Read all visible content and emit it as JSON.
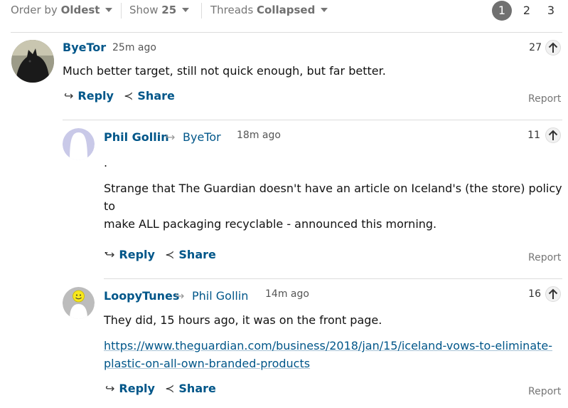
{
  "controls": {
    "order_label": "Order by",
    "order_value": "Oldest",
    "show_label": "Show",
    "show_value": "25",
    "threads_label": "Threads",
    "threads_value": "Collapsed",
    "pages": [
      "1",
      "2",
      "3"
    ],
    "active_page": "1"
  },
  "comments": [
    {
      "author": "ByeTor",
      "time": "25m ago",
      "votes": "27",
      "paragraphs": [
        "Much better target, still not quick enough, but far better."
      ],
      "reply_label": "Reply",
      "share_label": "Share",
      "report_label": "Report"
    },
    {
      "author": "Phil Gollin",
      "in_reply_to": "ByeTor",
      "time": "18m ago",
      "votes": "11",
      "paragraphs": [
        ".",
        "Strange that The Guardian doesn't have an article on Iceland's (the store) policy to",
        "make ALL packaging recyclable - announced this morning.",
        "."
      ],
      "reply_label": "Reply",
      "share_label": "Share",
      "report_label": "Report"
    },
    {
      "author": "LoopyTunes",
      "in_reply_to": "Phil Gollin",
      "time": "14m ago",
      "votes": "16",
      "paragraphs": [
        "They did, 15 hours ago, it was on the front page."
      ],
      "link_lines": [
        "https://www.theguardian.com/business/2018/jan/15/iceland-vows-to-eliminate-",
        "plastic-on-all-own-branded-products"
      ],
      "reply_label": "Reply",
      "share_label": "Share",
      "report_label": "Report"
    }
  ]
}
